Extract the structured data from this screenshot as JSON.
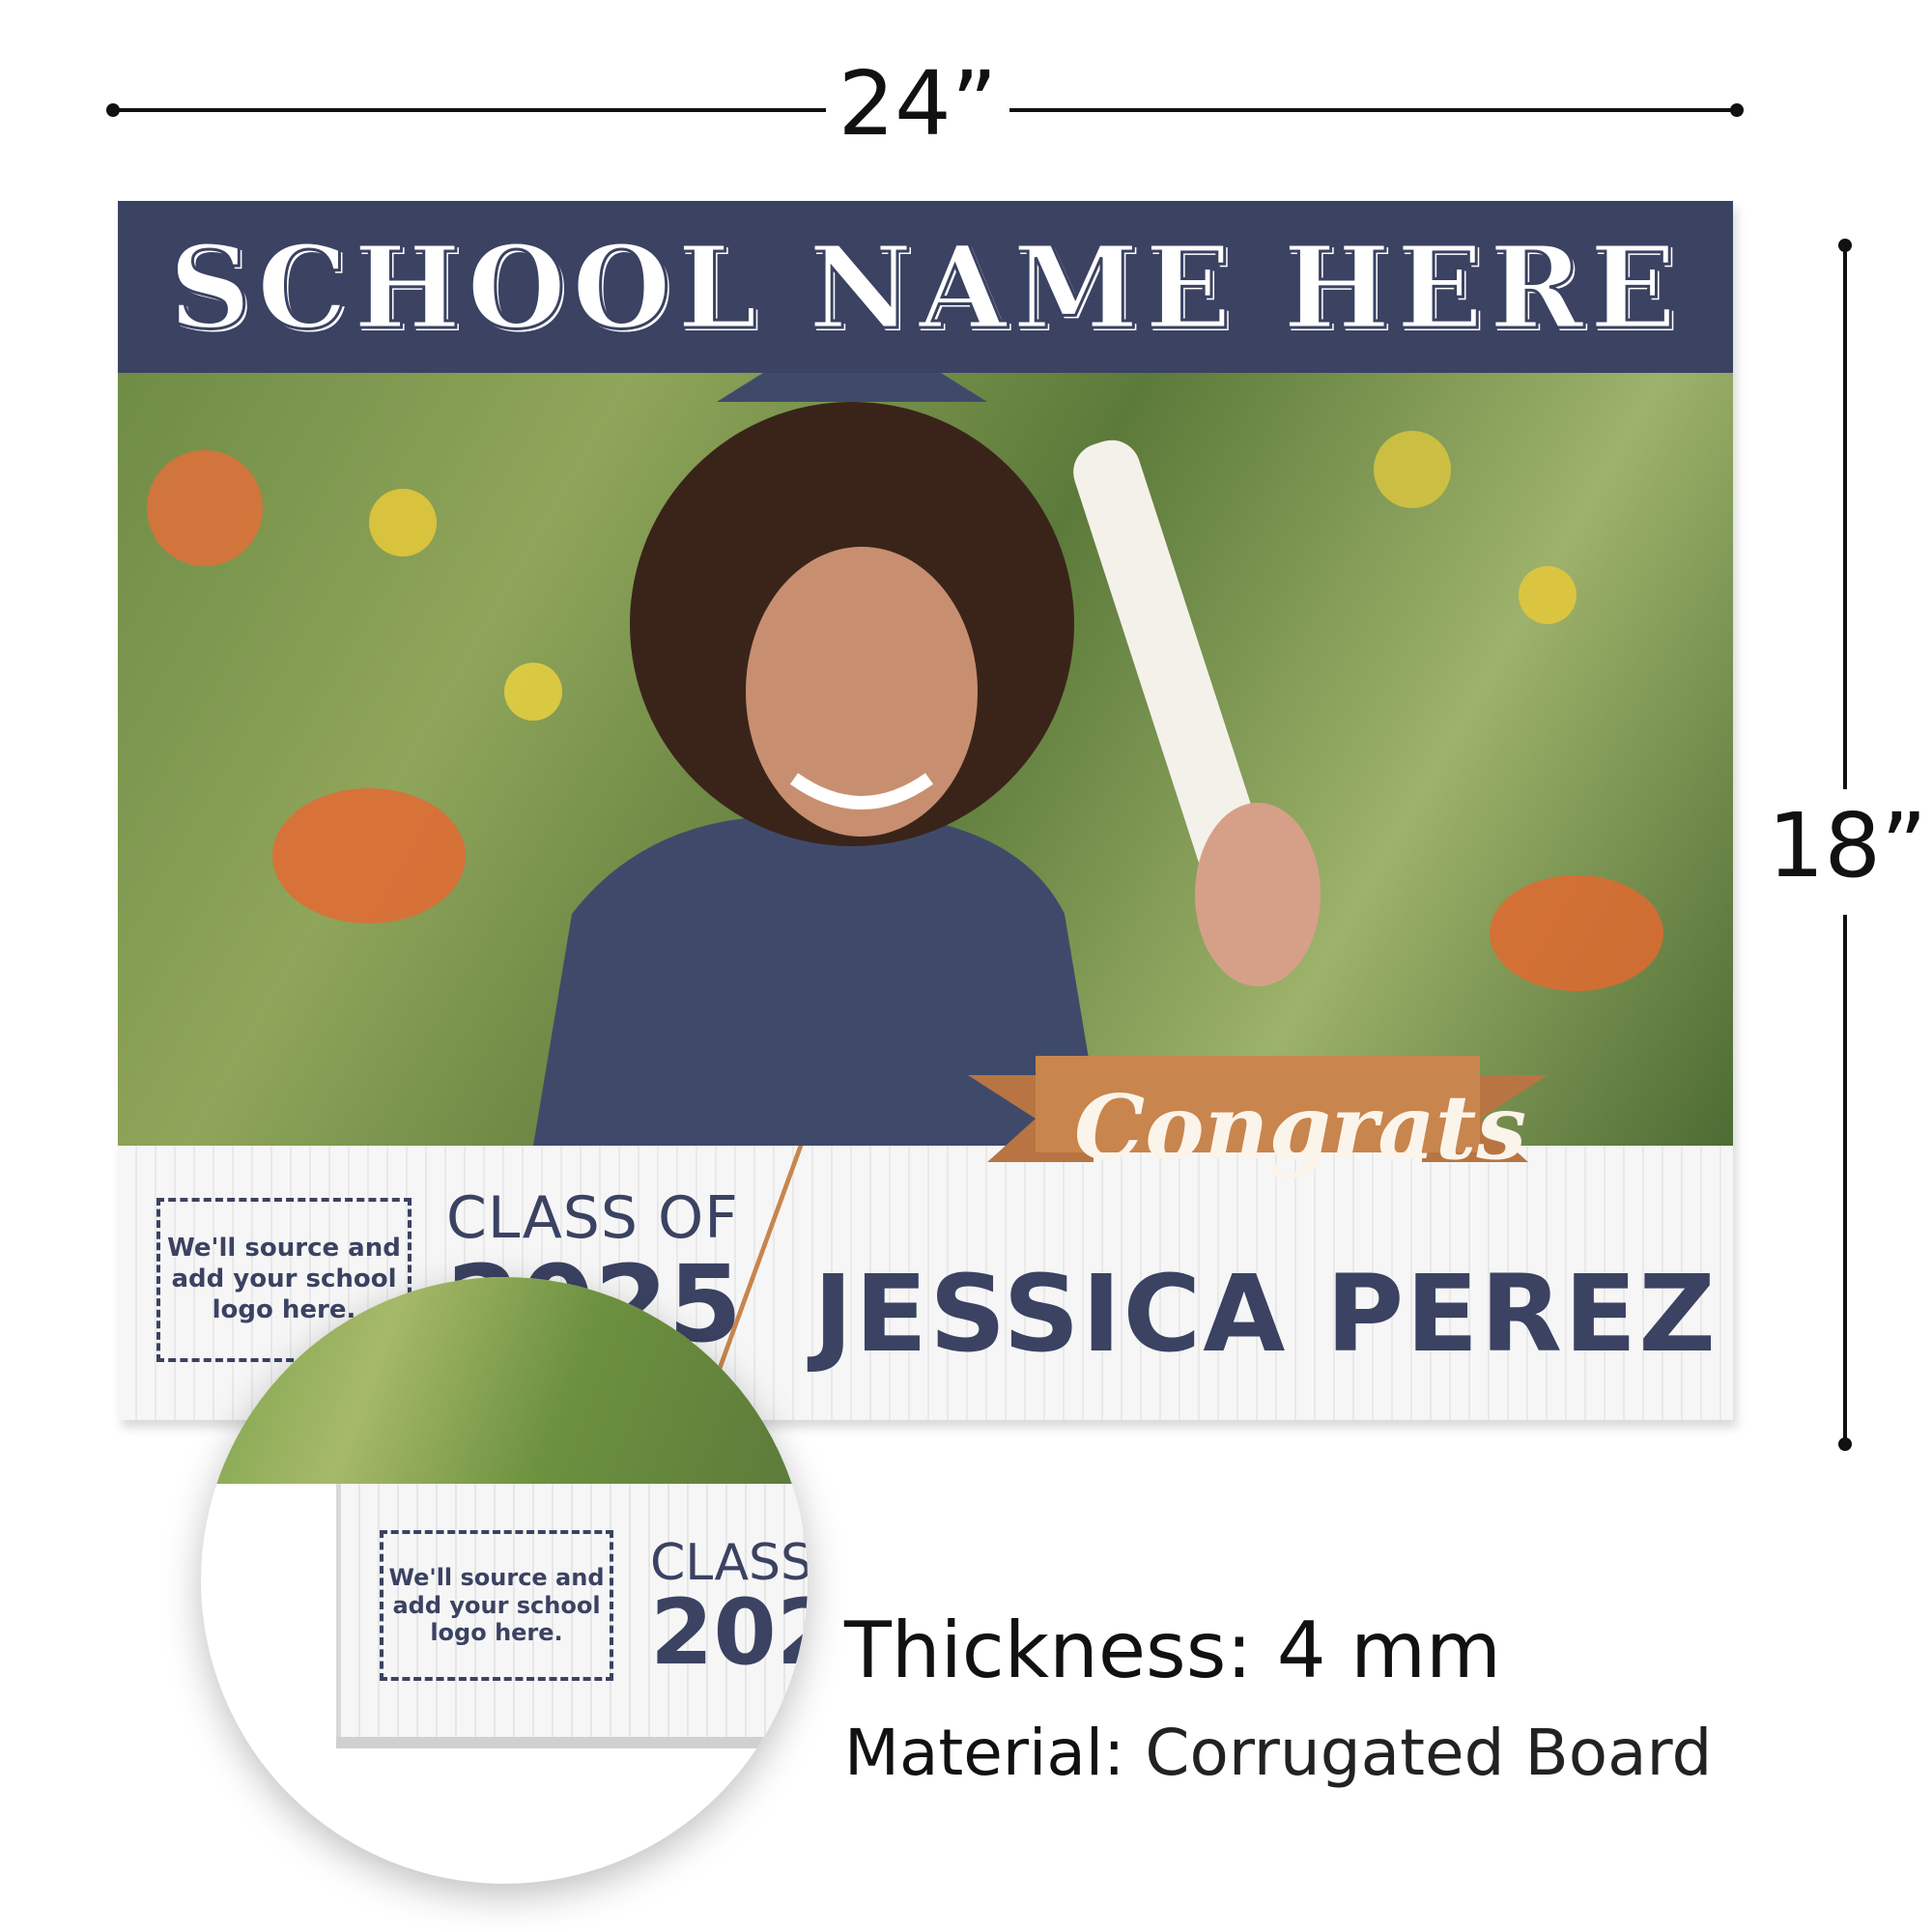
{
  "dimensions": {
    "width_label": "24”",
    "height_label": "18”"
  },
  "sign": {
    "school_name": "SCHOOL NAME HERE",
    "congrats": "Congrats",
    "class_of": "CLASS OF",
    "year": "2025",
    "graduate_name": "JESSICA PEREZ",
    "logo_placeholder": "We'll source and add your school logo here.",
    "colors": {
      "navy": "#3b4262",
      "copper": "#c8854d",
      "board": "#f6f6f6"
    }
  },
  "magnifier": {
    "logo_placeholder": "We'll source and add your school logo here.",
    "class_partial": "CLASS",
    "year_partial": "202"
  },
  "specs": {
    "thickness_label": "Thickness:",
    "thickness_value": "4 mm",
    "material_label": "Material:",
    "material_value": "Corrugated Board"
  }
}
